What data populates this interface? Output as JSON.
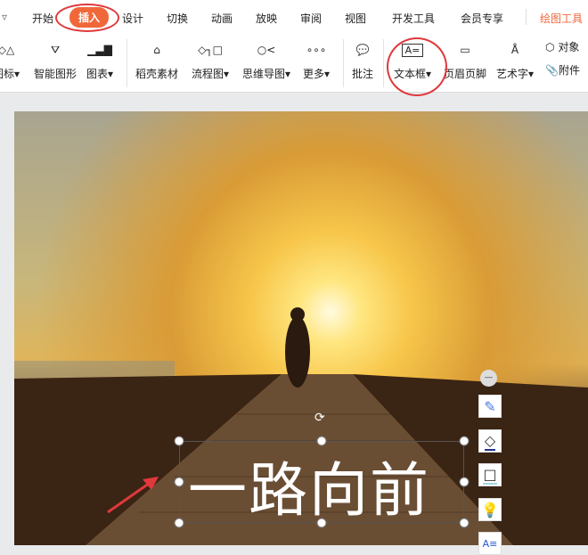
{
  "tabs": [
    "开始",
    "插入",
    "设计",
    "切换",
    "动画",
    "放映",
    "审阅",
    "视图",
    "开发工具",
    "会员专享",
    "绘图工具"
  ],
  "ribbon": {
    "icon": "图标",
    "smart": "智能图形",
    "chart": "图表",
    "daoke": "稻壳素材",
    "flow": "流程图",
    "mind": "思维导图",
    "more": "更多",
    "comment": "批注",
    "textbox": "文本框",
    "header": "页眉页脚",
    "wordart": "艺术字",
    "object": "对象",
    "attach": "附件"
  },
  "slide": {
    "text": "一路向前"
  },
  "colors": {
    "accent": "#f0683a",
    "annotation": "#e0393b"
  }
}
